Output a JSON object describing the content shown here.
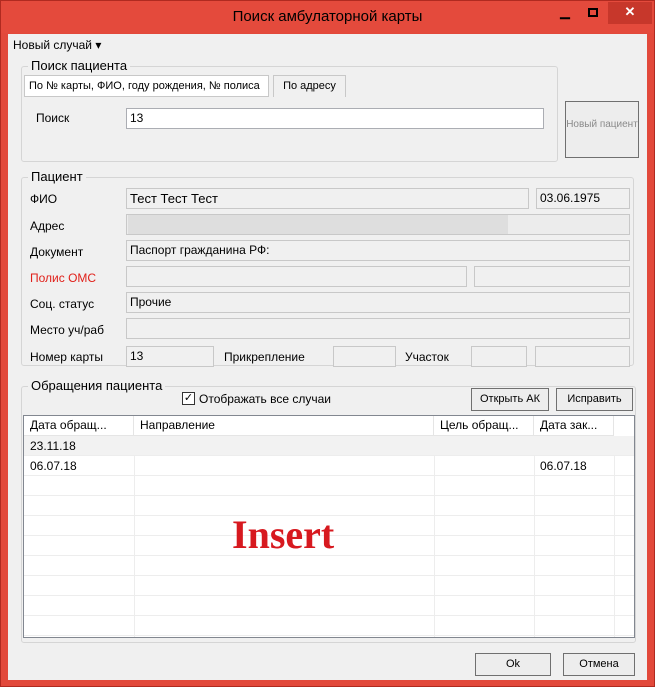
{
  "window": {
    "title": "Поиск амбулаторной карты",
    "minimize_glyph": "▁",
    "close_glyph": "✕"
  },
  "menu": {
    "new_case": "Новый случай",
    "arrow": "▾"
  },
  "search": {
    "group_label": "Поиск пациента",
    "tabs": [
      "По № карты, ФИО, году рождения, № полиса",
      "По адресу"
    ],
    "search_label": "Поиск",
    "search_value": "13",
    "new_patient_button": "Новый пациент"
  },
  "patient": {
    "group_label": "Пациент",
    "labels": {
      "fio": "ФИО",
      "address": "Адрес",
      "document": "Документ",
      "policy": "Полис ОМС",
      "social_status": "Соц. статус",
      "workplace": "Место уч/раб",
      "card_number": "Номер карты",
      "attachment": "Прикрепление",
      "district": "Участок"
    },
    "values": {
      "fio": "Тест Тест Тест",
      "birth_date": "03.06.1975",
      "address": "",
      "document": "Паспорт гражданина РФ:",
      "policy_1": "",
      "policy_2": "",
      "social_status": "Прочие",
      "workplace": "",
      "card_number": "13",
      "attachment": "",
      "district_1": "",
      "district_2": ""
    },
    "colors": {
      "policy_label": "#e0201a"
    }
  },
  "visits": {
    "group_label": "Обращения пациента",
    "show_all_label": "Отображать все случаи",
    "show_all_checked": true,
    "check_glyph": "✓",
    "open_ak_button": "Открыть АК",
    "fix_button": "Исправить",
    "columns": [
      "Дата обращ...",
      "Направление",
      "Цель обращ...",
      "Дата зак..."
    ],
    "rows": [
      {
        "date": "23.11.18",
        "direction": "",
        "purpose": "",
        "close_date": ""
      },
      {
        "date": "06.07.18",
        "direction": "",
        "purpose": "",
        "close_date": "06.07.18"
      }
    ]
  },
  "watermark": "Insert",
  "footer": {
    "ok_button": "Ok",
    "cancel_button": "Отмена"
  }
}
